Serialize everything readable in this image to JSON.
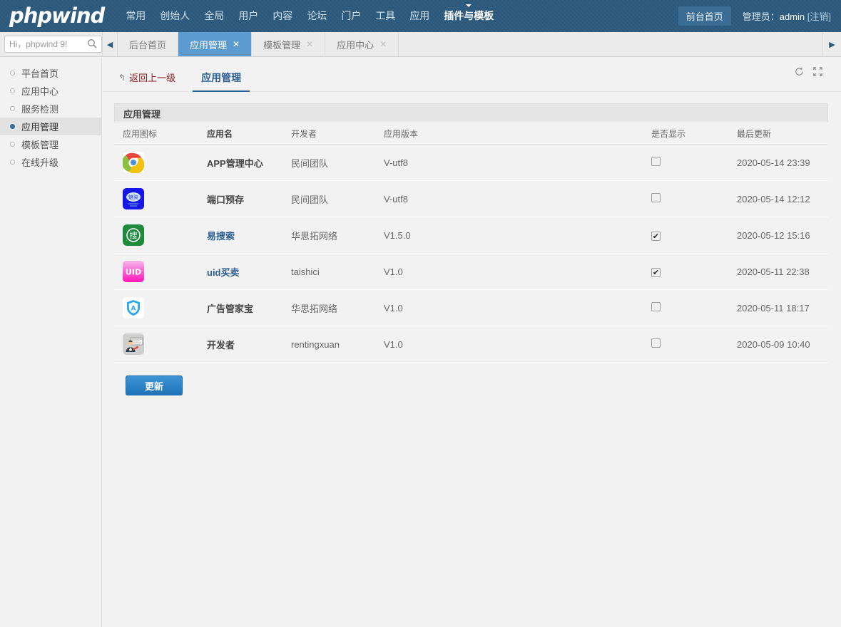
{
  "header": {
    "logo": "phpwind",
    "nav": [
      {
        "label": "常用",
        "active": false
      },
      {
        "label": "创始人",
        "active": false
      },
      {
        "label": "全局",
        "active": false
      },
      {
        "label": "用户",
        "active": false
      },
      {
        "label": "内容",
        "active": false
      },
      {
        "label": "论坛",
        "active": false
      },
      {
        "label": "门户",
        "active": false
      },
      {
        "label": "工具",
        "active": false
      },
      {
        "label": "应用",
        "active": false
      },
      {
        "label": "插件与模板",
        "active": true
      }
    ],
    "front_home": "前台首页",
    "admin_prefix": "管理员：",
    "admin_name": "admin",
    "logout": "[注销]"
  },
  "tabbar": {
    "search_placeholder": "Hi，phpwind 9!",
    "search_value": "",
    "search_icon": "search-icon",
    "prev_icon": "triangle-left-icon",
    "next_icon": "triangle-right-icon",
    "tabs": [
      {
        "label": "后台首页",
        "active": false,
        "closable": false
      },
      {
        "label": "应用管理",
        "active": true,
        "closable": true
      },
      {
        "label": "模板管理",
        "active": false,
        "closable": true
      },
      {
        "label": "应用中心",
        "active": false,
        "closable": true
      }
    ],
    "close_glyph": "✕"
  },
  "sidebar": {
    "items": [
      {
        "label": "平台首页",
        "active": false
      },
      {
        "label": "应用中心",
        "active": false
      },
      {
        "label": "服务检测",
        "active": false
      },
      {
        "label": "应用管理",
        "active": true
      },
      {
        "label": "模板管理",
        "active": false
      },
      {
        "label": "在线升级",
        "active": false
      }
    ]
  },
  "content": {
    "back_label": "返回上一级",
    "back_icon": "back-arrow-icon",
    "tab_label": "应用管理",
    "refresh_icon": "refresh-icon",
    "fullscreen_icon": "fullscreen-icon",
    "panel_title": "应用管理",
    "columns": [
      "应用图标",
      "应用名",
      "开发者",
      "应用版本",
      "是否显示",
      "最后更新"
    ],
    "rows": [
      {
        "icon": "chrome-app-icon",
        "name": "APP管理中心",
        "is_link": false,
        "developer": "民间团队",
        "version": "V-utf8",
        "shown": false,
        "updated": "2020-05-14 23:39"
      },
      {
        "icon": "meiran-app-icon",
        "name": "端口预存",
        "is_link": false,
        "developer": "民间团队",
        "version": "V-utf8",
        "shown": false,
        "updated": "2020-05-14 12:12"
      },
      {
        "icon": "search-app-icon",
        "name": "易搜索",
        "is_link": true,
        "developer": "华思拓网络",
        "version": "V1.5.0",
        "shown": true,
        "updated": "2020-05-12 15:16"
      },
      {
        "icon": "uid-app-icon",
        "name": "uid买卖",
        "is_link": true,
        "developer": "taishici",
        "version": "V1.0",
        "shown": true,
        "updated": "2020-05-11 22:38"
      },
      {
        "icon": "shield-app-icon",
        "name": "广告管家宝",
        "is_link": false,
        "developer": "华思拓网络",
        "version": "V1.0",
        "shown": false,
        "updated": "2020-05-11 18:17"
      },
      {
        "icon": "developer-app-icon",
        "name": "开发者",
        "is_link": false,
        "developer": "rentingxuan",
        "version": "V1.0",
        "shown": false,
        "updated": "2020-05-09 10:40"
      }
    ],
    "update_button": "更新",
    "checked_glyph": "✔"
  },
  "colors": {
    "topbar": "#2c5a7e",
    "tab_active": "#5b9bd0",
    "link": "#2b5f93",
    "back_link": "#8b2020",
    "button": "#2b82c7"
  }
}
